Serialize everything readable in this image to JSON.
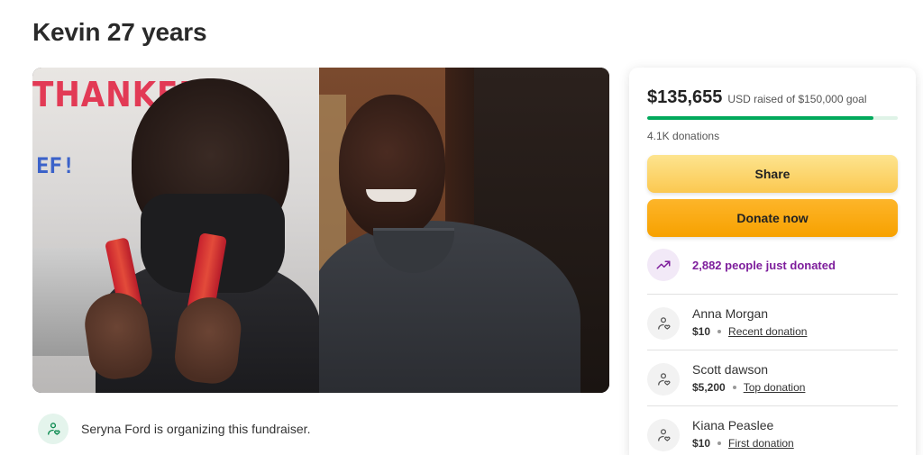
{
  "page": {
    "title": "Kevin 27 years"
  },
  "hero": {
    "sign_text": "THANKFUL",
    "side_text": "EF!"
  },
  "organizer": {
    "text": "Seryna Ford is organizing this fundraiser."
  },
  "card": {
    "raised_amount": "$135,655",
    "raised_goal": "USD raised of $150,000 goal",
    "progress_fraction": 0.904,
    "donation_count": "4.1K donations",
    "share_label": "Share",
    "donate_label": "Donate now",
    "trend_text": "2,882 people just donated",
    "donors": [
      {
        "name": "Anna Morgan",
        "amount": "$10",
        "tag": "Recent donation"
      },
      {
        "name": "Scott dawson",
        "amount": "$5,200",
        "tag": "Top donation"
      },
      {
        "name": "Kiana Peaslee",
        "amount": "$10",
        "tag": "First donation"
      }
    ]
  },
  "colors": {
    "progress": "#02a95c",
    "trend": "#7e1e9c",
    "donate": "#f7a100",
    "share": "#fbc850"
  },
  "icons": {
    "organizer": "heart-hand-icon",
    "trend": "trending-up-icon",
    "donor": "heart-hand-icon"
  }
}
